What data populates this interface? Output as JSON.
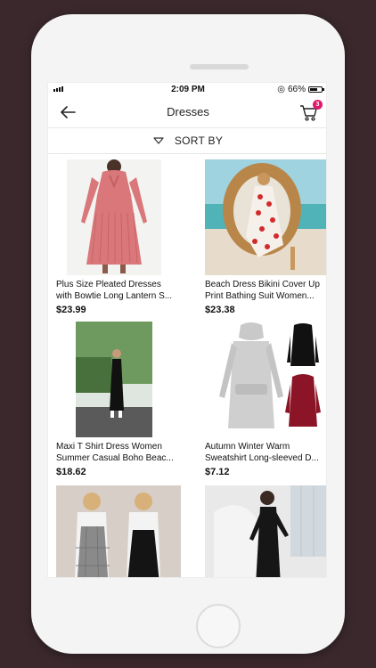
{
  "statusbar": {
    "time": "2:09 PM",
    "battery_percent": "66%",
    "battery_level": 0.66
  },
  "navbar": {
    "title": "Dresses",
    "cart_count": "3"
  },
  "sort": {
    "label": "SORT BY"
  },
  "products": [
    {
      "line1": "Plus Size Pleated Dresses",
      "line2": "with Bowtie Long Lantern S...",
      "price": "$23.99"
    },
    {
      "line1": "Beach Dress Bikini Cover Up",
      "line2": "Print Bathing Suit Women...",
      "price": "$23.38"
    },
    {
      "line1": "Maxi T Shirt Dress Women",
      "line2": "Summer Casual Boho Beac...",
      "price": "$18.62"
    },
    {
      "line1": "Autumn Winter Warm",
      "line2": "Sweatshirt Long-sleeved D...",
      "price": "$7.12"
    }
  ],
  "colors": {
    "accent": "#e0186c",
    "background": "#3a282c"
  }
}
